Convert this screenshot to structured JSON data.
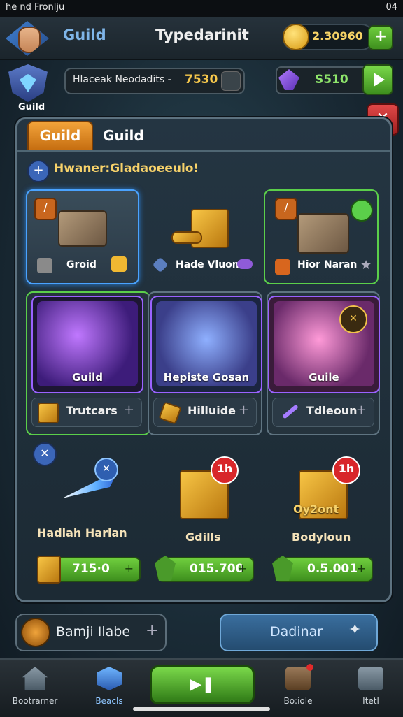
{
  "status_bar": {
    "left": "he nd Fronlju",
    "right": "04"
  },
  "header": {
    "guild_label": "Guild",
    "title": "Typedarinit",
    "coins": "2.30960",
    "plus": "+"
  },
  "guild_badge": {
    "label": "Guild"
  },
  "info": {
    "text": "Hlaceak Neodadits -",
    "value": "7530"
  },
  "gems": {
    "value": "S510"
  },
  "panel": {
    "tabs": [
      "Guild",
      "Guild"
    ],
    "notice": "Hwaner:Gladaoeeulo!",
    "items": [
      {
        "label": "Groid"
      },
      {
        "label": "Hade Vluon"
      },
      {
        "label": "Hior Naran"
      }
    ],
    "heroes": [
      {
        "name": "Guild",
        "sub": "Trutcars"
      },
      {
        "name": "Hepiste Gosan",
        "sub": "Hilluide"
      },
      {
        "name": "Guile",
        "sub": "Tdleoun"
      }
    ],
    "offers": [
      {
        "name": "Hadiah Harian",
        "price": "715·0",
        "badge": ""
      },
      {
        "name": "Gdills",
        "price": "015.700",
        "badge": "1h"
      },
      {
        "name": "Bodyloun",
        "price": "0.5.001",
        "badge": "1h",
        "overlay": "Oy2ont"
      }
    ]
  },
  "actions": {
    "left": "Bamji Ilabe",
    "right": "Dadinar"
  },
  "nav": {
    "items": [
      "Bootrarner",
      "Beacls",
      "Bo:iole",
      "Itetl"
    ]
  },
  "colors": {
    "accent": "#f2a33a",
    "green": "#5bcf4a",
    "panel": "#243542",
    "gold": "#f6d366"
  }
}
